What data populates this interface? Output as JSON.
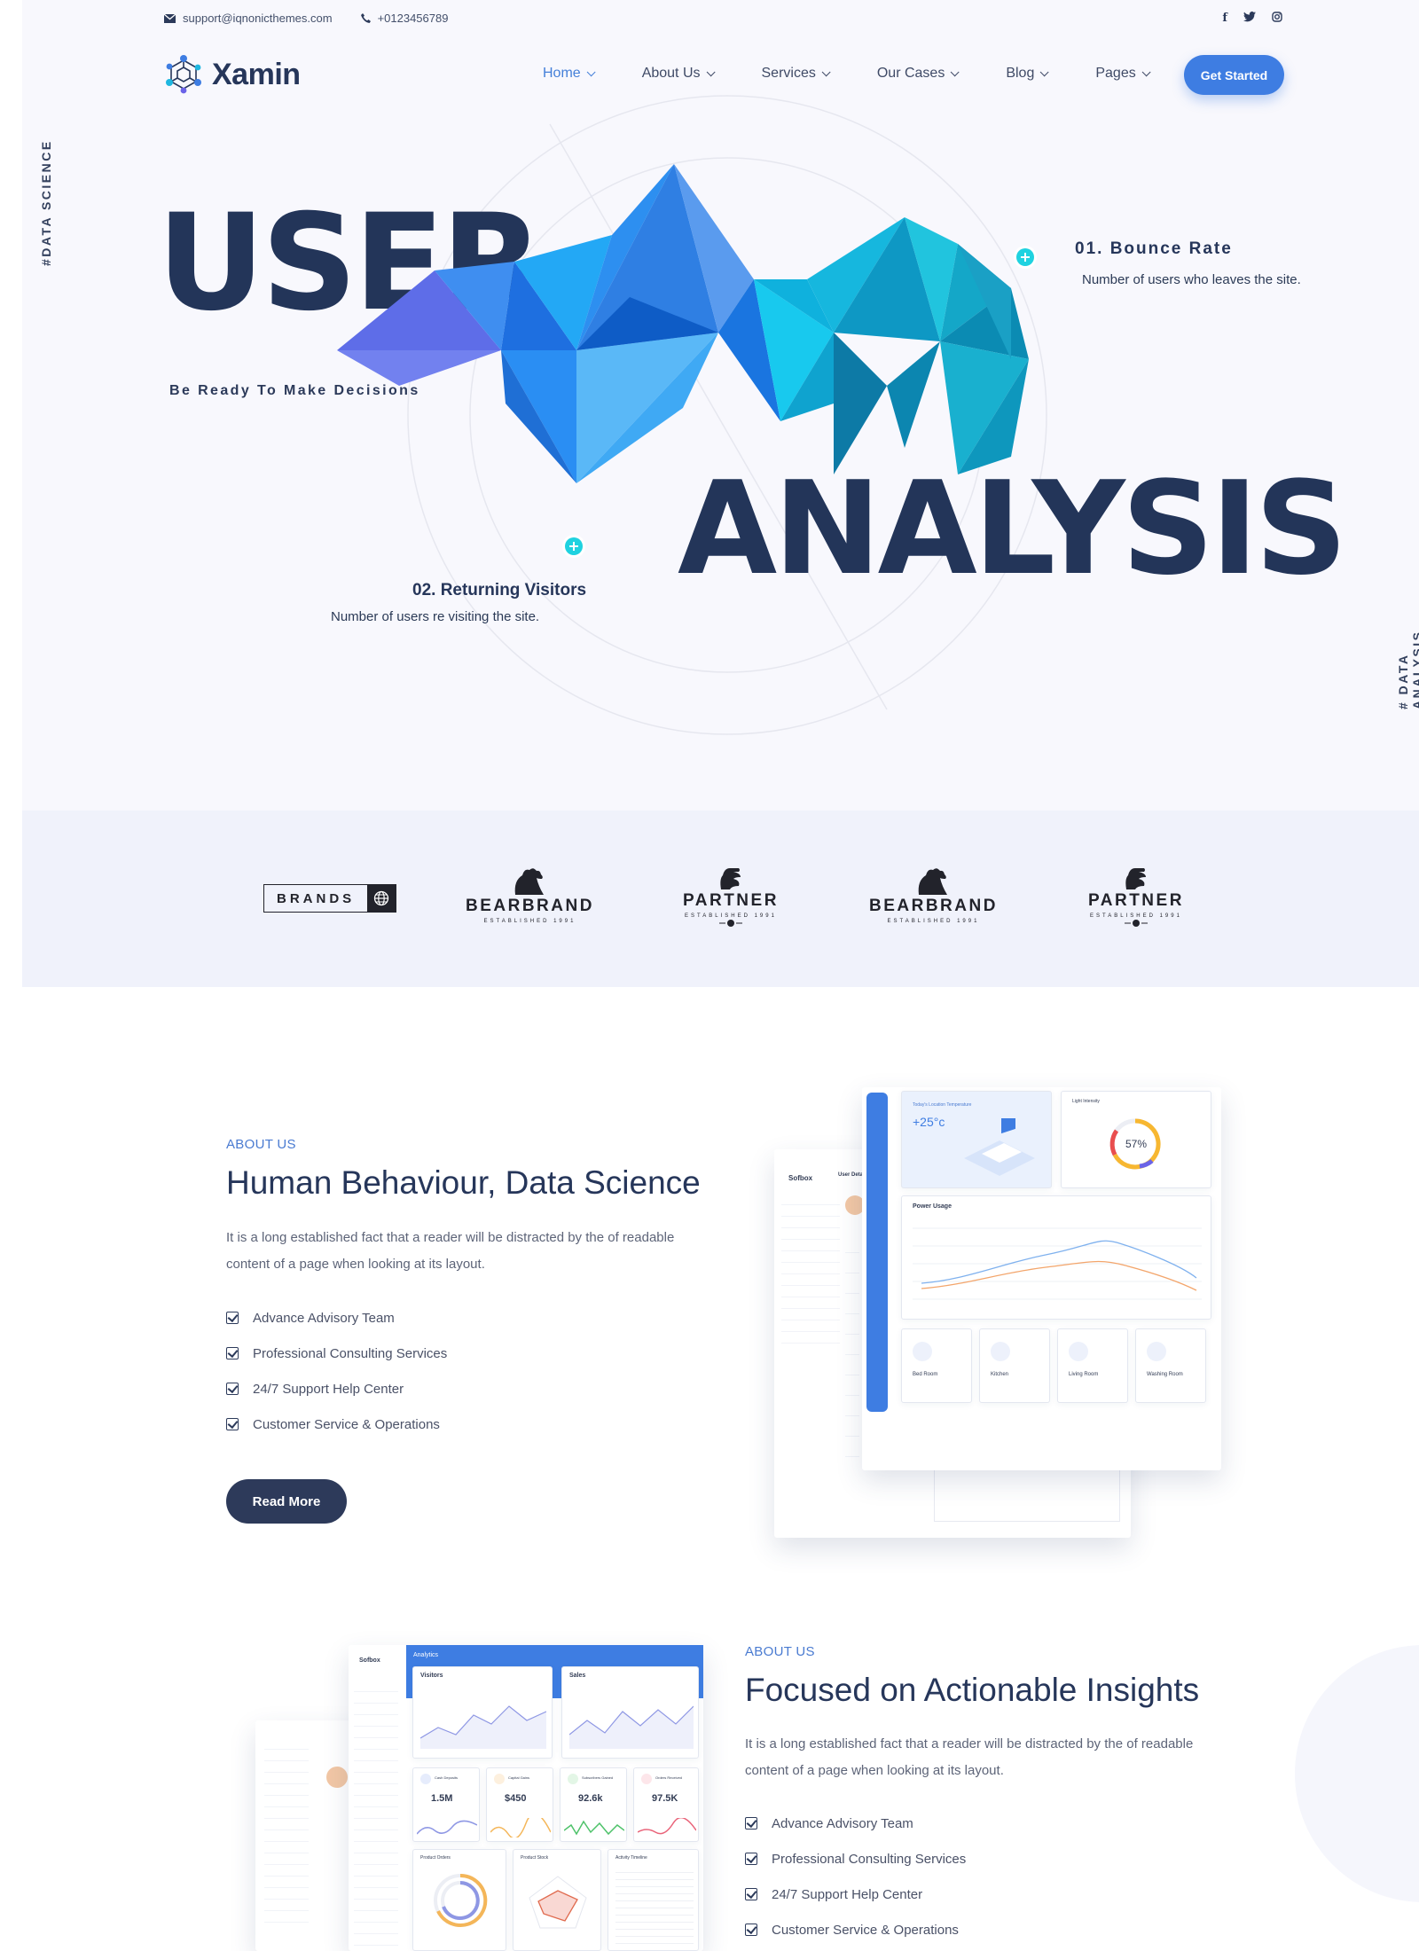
{
  "topbar": {
    "email": "support@iqnonicthemes.com",
    "phone": "+0123456789"
  },
  "social": {
    "facebook": "f",
    "twitter": "t",
    "instagram": "ig"
  },
  "brand": {
    "name": "Xamin"
  },
  "nav": {
    "items": [
      {
        "label": "Home"
      },
      {
        "label": "About Us"
      },
      {
        "label": "Services"
      },
      {
        "label": "Our Cases"
      },
      {
        "label": "Blog"
      },
      {
        "label": "Pages"
      }
    ],
    "cta": "Get Started"
  },
  "hero": {
    "side_left": "#DATA SCIENCE",
    "side_right": "# DATA ANALYSIS",
    "word1": "USER",
    "word2": "ANALYSIS",
    "tagline": "Be Ready To Make Decisions",
    "stat1": {
      "title": "01. Bounce Rate",
      "desc": "Number of users who leaves the site."
    },
    "stat2": {
      "title": "02. Returning Visitors",
      "desc": "Number of users re visiting the site."
    }
  },
  "brands": [
    {
      "name": "BRANDS",
      "sub": ""
    },
    {
      "name": "BEARBRAND",
      "sub": "ESTABLISHED 1991"
    },
    {
      "name": "PARTNER",
      "sub": "ESTABLISHED 1991"
    },
    {
      "name": "BEARBRAND",
      "sub": "ESTABLISHED 1991"
    },
    {
      "name": "PARTNER",
      "sub": "ESTABLISHED 1991"
    }
  ],
  "section1": {
    "eyebrow": "ABOUT US",
    "title": "Human Behaviour, Data Science",
    "text": "It is a long established fact that a reader will be distracted by the of readable content of a page when looking at its layout.",
    "list": [
      "Advance Advisory Team",
      "Professional Consulting Services",
      "24/7 Support Help Center",
      "Customer Service & Operations"
    ],
    "button": "Read More"
  },
  "section2": {
    "eyebrow": "ABOUT US",
    "title": "Focused on Actionable Insights",
    "text": "It is a long established fact that a reader will be distracted by the of readable content of a page when looking at its layout.",
    "list": [
      "Advance Advisory Team",
      "Professional Consulting Services",
      "24/7 Support Help Center",
      "Customer Service & Operations"
    ]
  },
  "dash1": {
    "temp_label": "Today's Location Temperature",
    "temp": "+25°c",
    "light_label": "Light Intensity",
    "light_value": "57%",
    "power_title": "Power Usage",
    "rooms": [
      "Bed Room",
      "Kitchen",
      "Living Room",
      "Washing Room"
    ],
    "back_logo": "Sofbox",
    "back_user": "User Details"
  },
  "dash2": {
    "logo": "Sofbox",
    "header": "Analytics",
    "visitors": "Visitors",
    "sales": "Sales",
    "kpis": [
      {
        "label": "Cash Deposits",
        "value": "1.5M"
      },
      {
        "label": "Capital Gains",
        "value": "$450"
      },
      {
        "label": "Subscribers Gained",
        "value": "92.6k"
      },
      {
        "label": "Orders Received",
        "value": "97.5K"
      }
    ],
    "product_orders": "Product Orders",
    "product_stock": "Product Stock",
    "activity": "Activity Timeline"
  },
  "colors": {
    "accent": "#3e7de2",
    "navy": "#233559",
    "cyan": "#1fd2e0"
  }
}
